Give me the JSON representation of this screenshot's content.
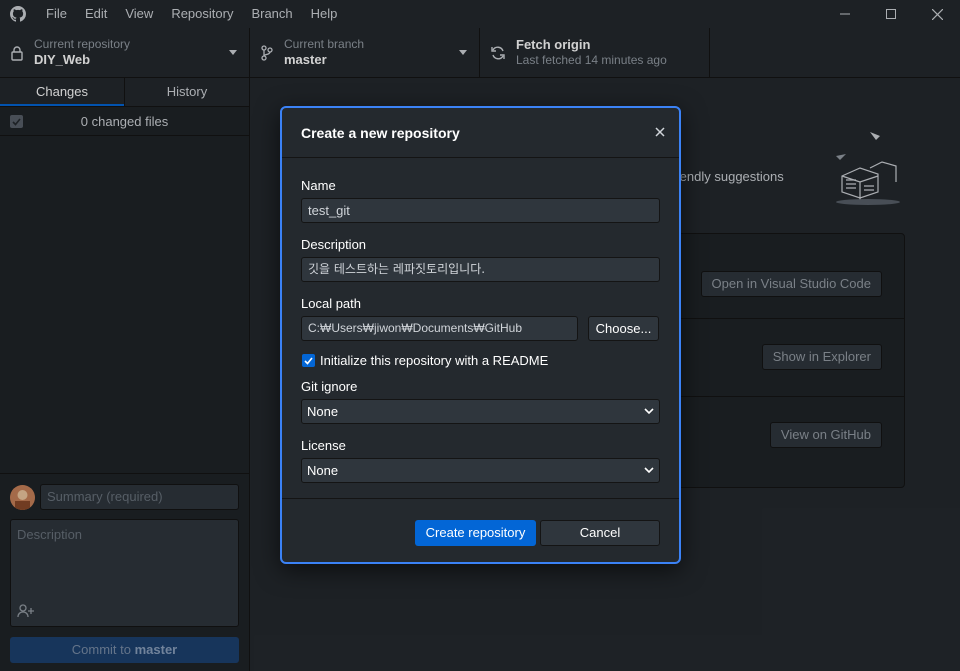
{
  "menu": [
    "File",
    "Edit",
    "View",
    "Repository",
    "Branch",
    "Help"
  ],
  "toolbar": {
    "repo_label": "Current repository",
    "repo_value": "DIY_Web",
    "branch_label": "Current branch",
    "branch_value": "master",
    "fetch_label": "Fetch origin",
    "fetch_sub": "Last fetched 14 minutes ago"
  },
  "sidebar": {
    "tabs": [
      "Changes",
      "History"
    ],
    "changed_files": "0 changed files",
    "summary_placeholder": "Summary (required)",
    "description_placeholder": "Description",
    "commit_button_prefix": "Commit to ",
    "commit_button_branch": "master"
  },
  "main": {
    "suggestions_text": "e friendly suggestions",
    "actions": [
      "Open in Visual Studio Code",
      "Show in Explorer",
      "View on GitHub"
    ]
  },
  "dialog": {
    "title": "Create a new repository",
    "name_label": "Name",
    "name_value": "test_git",
    "description_label": "Description",
    "description_value": "깃을 테스트하는 레파짓토리입니다.",
    "local_path_label": "Local path",
    "local_path_value": "C:₩Users₩jiwon₩Documents₩GitHub",
    "choose_button": "Choose...",
    "readme_label": "Initialize this repository with a README",
    "readme_checked": true,
    "gitignore_label": "Git ignore",
    "gitignore_value": "None",
    "license_label": "License",
    "license_value": "None",
    "create_button": "Create repository",
    "cancel_button": "Cancel"
  },
  "colors": {
    "accent": "#0366d6",
    "dialog_border": "#3b82f6",
    "background": "#24292e"
  }
}
